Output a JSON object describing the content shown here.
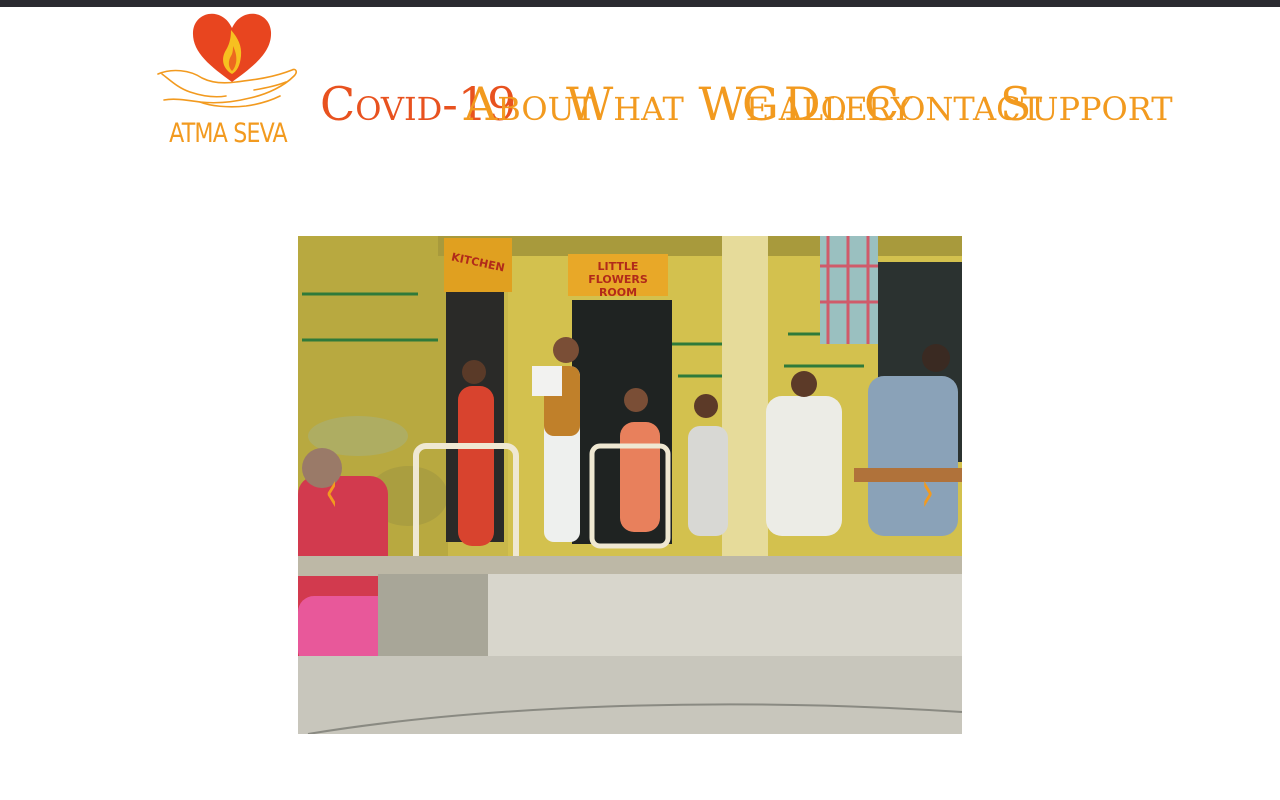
{
  "brand": {
    "name": "ATMA SEVA",
    "colors": {
      "heart": "#e8451f",
      "flame": "#f7c020",
      "text": "#f29a1f"
    },
    "icons": [
      "heart-icon",
      "flame-icon",
      "hand-icon"
    ]
  },
  "nav": {
    "items": [
      {
        "label": "Covid-19",
        "active": true
      },
      {
        "label": "About",
        "active": false
      },
      {
        "label": "What We Do",
        "active": false
      },
      {
        "label": "Gallery",
        "active": false
      },
      {
        "label": "Contact",
        "active": false
      },
      {
        "label": "Support",
        "active": false
      }
    ],
    "colors": {
      "default": "#f29a1f",
      "active": "#e8521f"
    }
  },
  "slider": {
    "prev_icon": "chevron-left-icon",
    "next_icon": "chevron-right-icon",
    "prev_glyph": "‹",
    "next_glyph": "›",
    "signs": {
      "kitchen": "KITCHEN",
      "room_line1": "LITTLE FLOWERS",
      "room_line2": "ROOM"
    }
  }
}
